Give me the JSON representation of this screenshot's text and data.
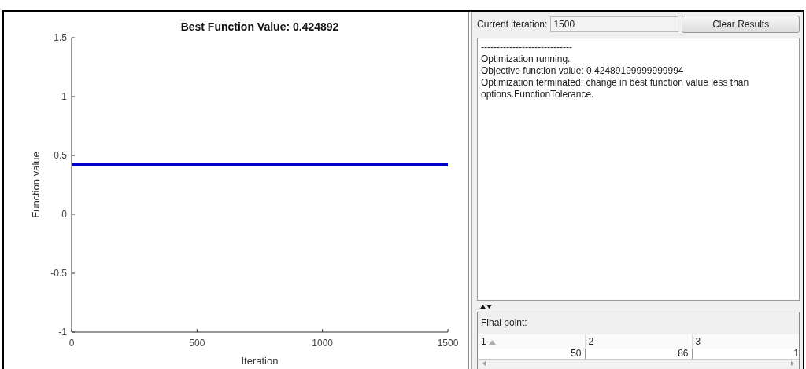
{
  "plot": {
    "chart_data": {
      "type": "line",
      "title": "Best Function Value: 0.424892",
      "xlabel": "Iteration",
      "ylabel": "Function value",
      "x": [
        0,
        1500
      ],
      "series": [
        {
          "color": "#0000c8",
          "values": [
            0.42,
            0.42
          ]
        }
      ],
      "xlim": [
        0,
        1500
      ],
      "ylim": [
        -1,
        1.5
      ],
      "xticks": [
        0,
        500,
        1000,
        1500
      ],
      "yticks": [
        -1,
        -0.5,
        0,
        0.5,
        1,
        1.5
      ]
    }
  },
  "controls": {
    "iteration_label": "Current iteration:",
    "iteration_value": "1500",
    "clear_button": "Clear Results"
  },
  "messages": [
    "-----------------------------",
    "Optimization running.",
    "Objective function value: 0.42489199999999994",
    "Optimization terminated: change in best function value less than options.FunctionTolerance."
  ],
  "final_point": {
    "label": "Final point:",
    "columns": [
      {
        "label": "1",
        "sorted": true
      },
      {
        "label": "2",
        "sorted": false
      },
      {
        "label": "3",
        "sorted": false
      }
    ],
    "values": [
      "50",
      "86",
      "1"
    ]
  }
}
